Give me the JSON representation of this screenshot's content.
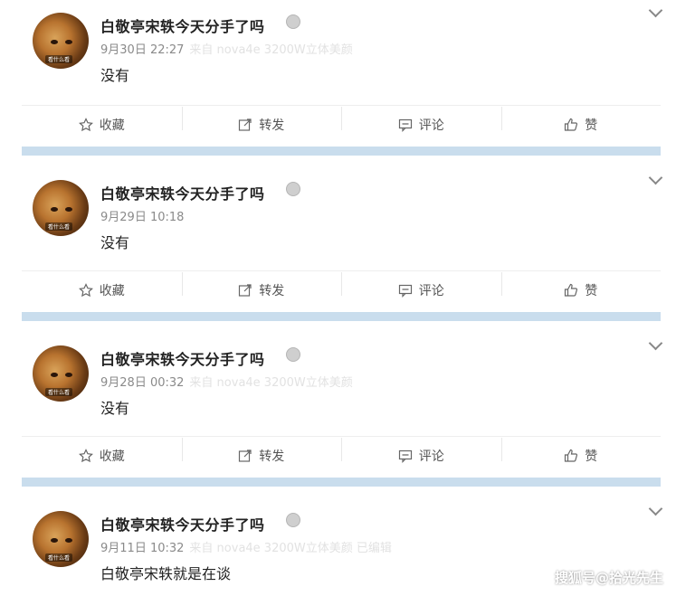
{
  "posts": [
    {
      "name": "白敬亭宋轶今天分手了吗",
      "date": "9月30日 22:27",
      "source": "来自 nova4e 3200W立体美颜",
      "content": "没有"
    },
    {
      "name": "白敬亭宋轶今天分手了吗",
      "date": "9月29日 10:18",
      "source": "",
      "content": "没有"
    },
    {
      "name": "白敬亭宋轶今天分手了吗",
      "date": "9月28日 00:32",
      "source": "来自 nova4e 3200W立体美颜",
      "content": "没有"
    },
    {
      "name": "白敬亭宋轶今天分手了吗",
      "date": "9月11日 10:32",
      "source": "来自 nova4e 3200W立体美颜  已编辑",
      "content": "白敬亭宋轶就是在谈"
    }
  ],
  "actions": {
    "favorite": "收藏",
    "repost": "转发",
    "comment": "评论",
    "like": "赞"
  },
  "avatar_tag": "看什么看",
  "watermark": "搜狐号@拾光先生",
  "colors": {
    "separator": "#c9dded",
    "meta": "#8a8a8a"
  }
}
